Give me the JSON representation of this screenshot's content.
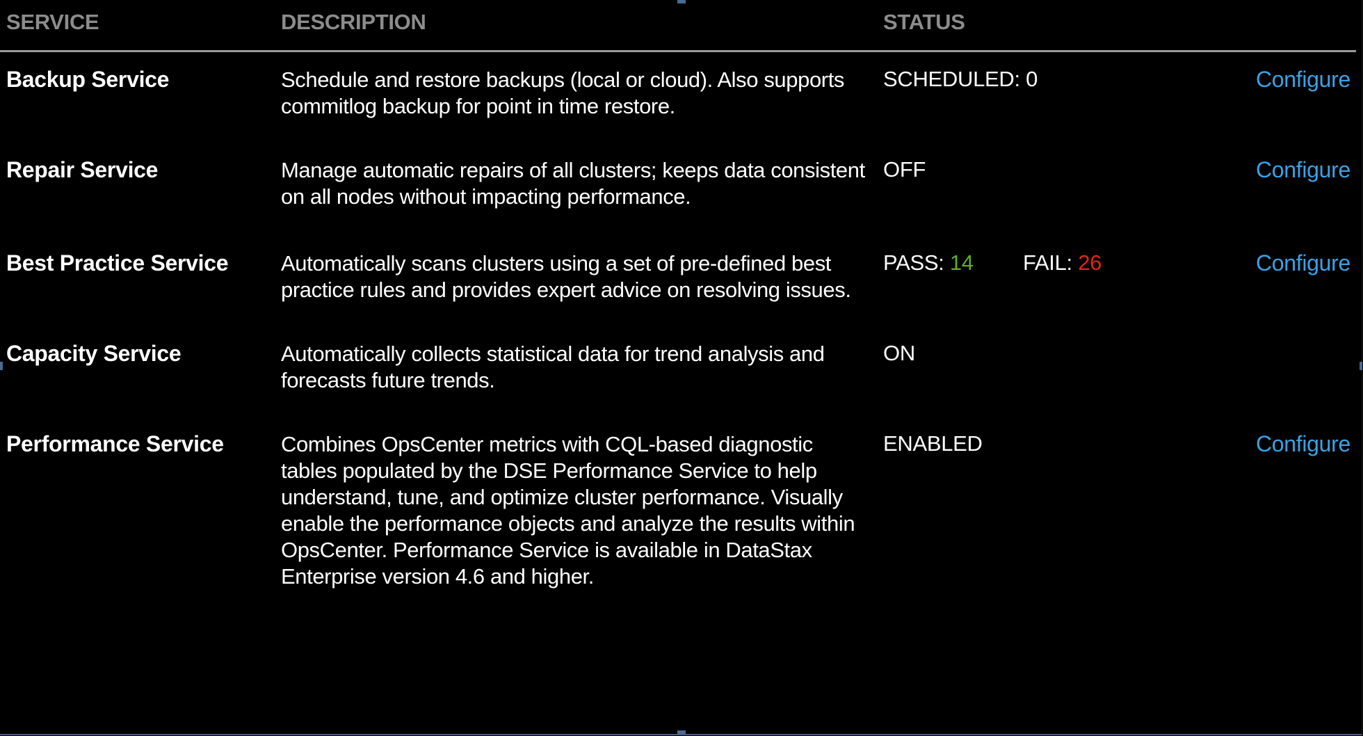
{
  "headers": {
    "service": "SERVICE",
    "description": "DESCRIPTION",
    "status": "STATUS"
  },
  "rows": [
    {
      "name": "Backup Service",
      "description": "Schedule and restore backups (local or cloud). Also supports commitlog backup for point in time restore.",
      "status": "SCHEDULED: 0",
      "action": "Configure"
    },
    {
      "name": "Repair Service",
      "description": "Manage automatic repairs of all clusters; keeps data consistent on all nodes without impacting performance.",
      "status": "OFF",
      "action": "Configure"
    },
    {
      "name": "Best Practice Service",
      "description": "Automatically scans clusters using a set of pre-defined best practice rules and provides expert advice on resolving issues.",
      "status_pass_label": "PASS:",
      "status_pass_value": "14",
      "status_fail_label": "FAIL:",
      "status_fail_value": "26",
      "action": "Configure"
    },
    {
      "name": "Capacity Service",
      "description": "Automatically collects statistical data for trend analysis and forecasts future trends.",
      "status": "ON"
    },
    {
      "name": "Performance Service",
      "description": "Combines OpsCenter metrics with CQL-based diagnostic tables populated by the DSE Performance Service to help understand, tune, and optimize cluster performance. Visually enable the performance objects and analyze the results within OpsCenter. Performance Service is available in DataStax Enterprise version 4.6 and higher.",
      "status": "ENABLED",
      "action": "Configure"
    }
  ],
  "colors": {
    "pass": "#5fae2a",
    "fail": "#e0251b",
    "link": "#3aa2e6",
    "header_text": "#8c8c8c"
  }
}
